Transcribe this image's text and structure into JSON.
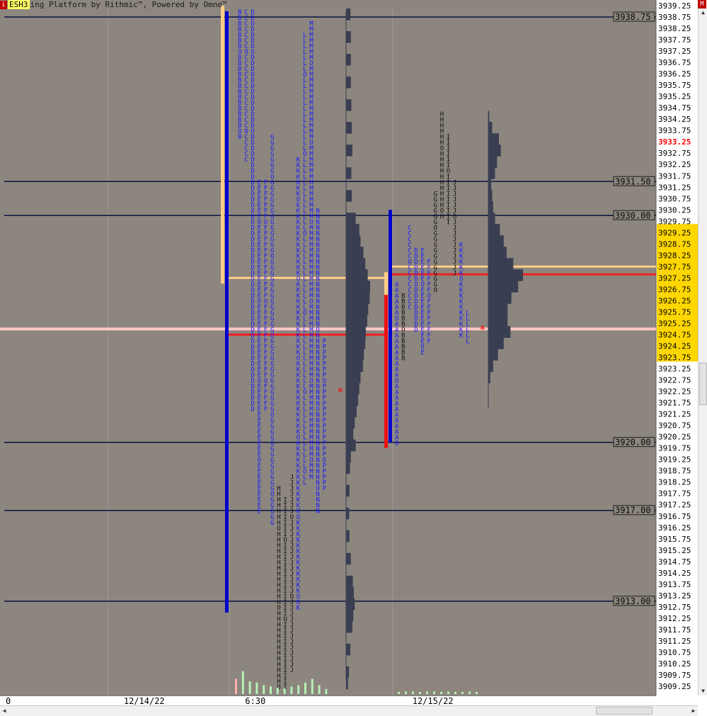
{
  "title_bar": {
    "icon_letter": "i",
    "symbol": "ESH3",
    "text": "ing Platform by Rithmic™, Powered by Omne™",
    "corner_label": "M"
  },
  "colors": {
    "background": "#8c867e",
    "price_axis_bg": "#ffffff",
    "highlight_band": "#ffd700",
    "blue_column": "#0000cc",
    "red_column": "#ee1111",
    "poc_red": "#ee2222",
    "vah_tan": "#ffcc88",
    "pink_line": "#ffc8c8",
    "profile_fill": "#3a3e52",
    "letter_blue": "#1a1aff",
    "letter_black": "#111111",
    "level_line": "#0a1240",
    "current_price": "#ff0000"
  },
  "chart_data": {
    "type": "market_profile",
    "y_axis": {
      "top": 3939.25,
      "bottom": 3909.25,
      "step": 0.25,
      "label_every": 0.5,
      "current_price": 3933.25,
      "highlight_band": [
        3923.75,
        3929.25
      ]
    },
    "x_axis": {
      "labels": [
        {
          "text": "0",
          "pos": 0.0
        },
        {
          "text": "12/14/22",
          "pos": 0.18
        },
        {
          "text": "6:30",
          "pos": 0.365
        },
        {
          "text": "12/15/22",
          "pos": 0.62
        }
      ]
    },
    "level_lines": [
      {
        "price": 3938.75,
        "label": "3938.75"
      },
      {
        "price": 3931.5,
        "label": "3931.50"
      },
      {
        "price": 3930.0,
        "label": "3930.00"
      },
      {
        "price": 3920.0,
        "label": "3920.00"
      },
      {
        "price": 3917.0,
        "label": "3917.00"
      },
      {
        "price": 3913.0,
        "label": "3913.00"
      }
    ],
    "pink_line_price": 3925.0,
    "sessions": [
      {
        "name": "12/14/22",
        "value_area": {
          "high": 3939.0,
          "low": 3912.5
        },
        "vah_marker": {
          "from": 3939.0,
          "to": 3927.0
        },
        "vah_price": 3927.25,
        "poc_price": 3924.75,
        "ib_star_price": 3922.25,
        "columns": [
          {
            "letter": "B",
            "high": 3939.0,
            "low": 3933.5
          },
          {
            "letter": "C",
            "high": 3939.0,
            "low": 3932.5
          },
          {
            "letter": "D",
            "high": 3939.0,
            "low": 3921.5
          },
          {
            "letter": "E",
            "high": 3931.5,
            "low": 3917.0
          },
          {
            "letter": "F",
            "high": 3931.5,
            "low": 3921.5
          },
          {
            "letter": "G",
            "high": 3933.5,
            "low": 3916.5
          },
          {
            "letter": "H",
            "high": 3918.0,
            "low": 3909.25
          },
          {
            "letter": "I",
            "high": 3917.5,
            "low": 3909.25
          },
          {
            "letter": "J",
            "high": 3918.5,
            "low": 3910.0
          },
          {
            "letter": "K",
            "high": 3932.5,
            "low": 3912.75
          },
          {
            "letter": "L",
            "high": 3938.0,
            "low": 3918.25
          },
          {
            "letter": "M",
            "high": 3938.5,
            "low": 3918.5
          },
          {
            "letter": "N",
            "high": 3930.25,
            "low": 3917.0
          },
          {
            "letter": "P",
            "high": 3924.5,
            "low": 3918.0
          }
        ],
        "volume": [
          {
            "price": 3939.0,
            "v": 0.18
          },
          {
            "price": 3938.0,
            "v": 0.2
          },
          {
            "price": 3937.0,
            "v": 0.2
          },
          {
            "price": 3936.0,
            "v": 0.2
          },
          {
            "price": 3935.0,
            "v": 0.22
          },
          {
            "price": 3934.0,
            "v": 0.24
          },
          {
            "price": 3933.0,
            "v": 0.26
          },
          {
            "price": 3932.0,
            "v": 0.22
          },
          {
            "price": 3931.0,
            "v": 0.24
          },
          {
            "price": 3930.0,
            "v": 0.4
          },
          {
            "price": 3929.5,
            "v": 0.55
          },
          {
            "price": 3929.0,
            "v": 0.6
          },
          {
            "price": 3928.5,
            "v": 0.72
          },
          {
            "price": 3928.0,
            "v": 0.8
          },
          {
            "price": 3927.5,
            "v": 0.9
          },
          {
            "price": 3927.0,
            "v": 1.0
          },
          {
            "price": 3926.5,
            "v": 0.98
          },
          {
            "price": 3926.0,
            "v": 0.92
          },
          {
            "price": 3925.5,
            "v": 0.88
          },
          {
            "price": 3925.0,
            "v": 0.82
          },
          {
            "price": 3924.5,
            "v": 0.8
          },
          {
            "price": 3924.0,
            "v": 0.74
          },
          {
            "price": 3923.5,
            "v": 0.7
          },
          {
            "price": 3923.0,
            "v": 0.6
          },
          {
            "price": 3922.5,
            "v": 0.55
          },
          {
            "price": 3922.0,
            "v": 0.5
          },
          {
            "price": 3921.5,
            "v": 0.44
          },
          {
            "price": 3921.0,
            "v": 0.36
          },
          {
            "price": 3920.5,
            "v": 0.3
          },
          {
            "price": 3920.0,
            "v": 0.4
          },
          {
            "price": 3919.5,
            "v": 0.2
          },
          {
            "price": 3919.0,
            "v": 0.16
          },
          {
            "price": 3918.0,
            "v": 0.14
          },
          {
            "price": 3917.0,
            "v": 0.13
          },
          {
            "price": 3916.0,
            "v": 0.14
          },
          {
            "price": 3915.0,
            "v": 0.2
          },
          {
            "price": 3914.0,
            "v": 0.28
          },
          {
            "price": 3913.5,
            "v": 0.32
          },
          {
            "price": 3913.0,
            "v": 0.36
          },
          {
            "price": 3912.5,
            "v": 0.3
          },
          {
            "price": 3912.0,
            "v": 0.26
          },
          {
            "price": 3911.0,
            "v": 0.18
          },
          {
            "price": 3910.0,
            "v": 0.12
          },
          {
            "price": 3909.5,
            "v": 0.08
          }
        ],
        "tpo_volume_bars": [
          0.6,
          0.9,
          0.5,
          0.45,
          0.35,
          0.3,
          0.25,
          0.22,
          0.3,
          0.35,
          0.45,
          0.6,
          0.35,
          0.2
        ]
      },
      {
        "name": "12/15/22",
        "value_area": {
          "high": 3930.0,
          "low": 3920.0
        },
        "ib_marker": {
          "from": 3927.5,
          "to": 3926.5
        },
        "red_ib": {
          "from": 3926.5,
          "to": 3919.75
        },
        "vah_price": 3927.75,
        "poc_price": 3927.5,
        "ib_star_price": 3925.0,
        "columns": [
          {
            "letter": "A",
            "high": 3927.0,
            "low": 3920.0
          },
          {
            "letter": "B",
            "high": 3926.5,
            "low": 3923.75
          },
          {
            "letter": "C",
            "high": 3929.5,
            "low": 3926.0
          },
          {
            "letter": "D",
            "high": 3928.5,
            "low": 3925.0
          },
          {
            "letter": "E",
            "high": 3928.5,
            "low": 3924.0
          },
          {
            "letter": "F",
            "high": 3928.0,
            "low": 3924.5
          },
          {
            "letter": "G",
            "high": 3931.0,
            "low": 3926.75
          },
          {
            "letter": "H",
            "high": 3934.5,
            "low": 3930.0
          },
          {
            "letter": "I",
            "high": 3933.5,
            "low": 3929.75
          },
          {
            "letter": "J",
            "high": 3931.5,
            "low": 3927.5
          },
          {
            "letter": "K",
            "high": 3928.75,
            "low": 3924.75
          },
          {
            "letter": "L",
            "high": 3925.75,
            "low": 3924.5
          }
        ],
        "volume": [
          {
            "price": 3934.5,
            "v": 0.02
          },
          {
            "price": 3934.0,
            "v": 0.08
          },
          {
            "price": 3933.5,
            "v": 0.22
          },
          {
            "price": 3933.0,
            "v": 0.26
          },
          {
            "price": 3932.5,
            "v": 0.18
          },
          {
            "price": 3932.0,
            "v": 0.14
          },
          {
            "price": 3931.5,
            "v": 0.06
          },
          {
            "price": 3931.0,
            "v": 0.08
          },
          {
            "price": 3930.5,
            "v": 0.1
          },
          {
            "price": 3930.0,
            "v": 0.14
          },
          {
            "price": 3929.5,
            "v": 0.24
          },
          {
            "price": 3929.0,
            "v": 0.32
          },
          {
            "price": 3928.5,
            "v": 0.38
          },
          {
            "price": 3928.0,
            "v": 0.52
          },
          {
            "price": 3927.5,
            "v": 0.72
          },
          {
            "price": 3927.0,
            "v": 0.62
          },
          {
            "price": 3926.5,
            "v": 0.48
          },
          {
            "price": 3926.0,
            "v": 0.4
          },
          {
            "price": 3925.5,
            "v": 0.4
          },
          {
            "price": 3925.0,
            "v": 0.46
          },
          {
            "price": 3924.5,
            "v": 0.32
          },
          {
            "price": 3924.0,
            "v": 0.2
          },
          {
            "price": 3923.5,
            "v": 0.1
          },
          {
            "price": 3923.0,
            "v": 0.04
          }
        ],
        "tpo_volume_bars": [
          0.05,
          0.06,
          0.06,
          0.05,
          0.06,
          0.06,
          0.05,
          0.06,
          0.05,
          0.05,
          0.06,
          0.05
        ]
      }
    ]
  }
}
